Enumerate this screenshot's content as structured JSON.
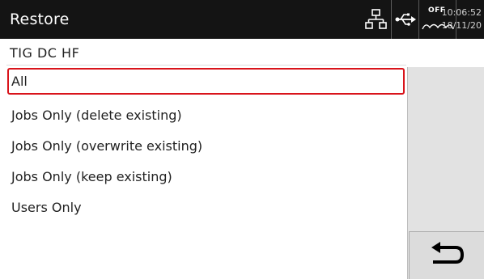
{
  "header": {
    "title": "Restore",
    "status": {
      "network_icon": "network-icon",
      "usb_icon": "usb-icon",
      "water_cooler_label": "OFF",
      "time": "10:06:52",
      "date": "18/11/20"
    }
  },
  "subheader": {
    "process": "TIG  DC  HF"
  },
  "menu": {
    "items": [
      {
        "label": "All",
        "selected": true
      },
      {
        "label": "Jobs Only (delete existing)",
        "selected": false
      },
      {
        "label": "Jobs Only (overwrite existing)",
        "selected": false
      },
      {
        "label": "Jobs Only (keep existing)",
        "selected": false
      },
      {
        "label": "Users Only",
        "selected": false
      }
    ]
  },
  "side_panel": {
    "back_icon": "return-arrow-icon"
  },
  "colors": {
    "titlebar": "#141414",
    "selection_border": "#d9141b",
    "side_panel": "#e2e2e2"
  }
}
